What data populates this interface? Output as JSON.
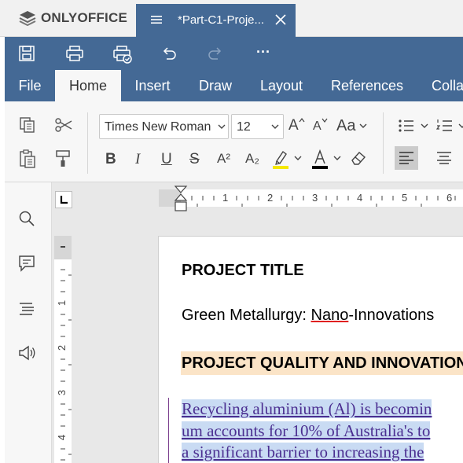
{
  "app": {
    "name": "ONLYOFFICE"
  },
  "document_tab": {
    "title": "*Part-C1-Proje..."
  },
  "quick_access": {
    "icons": [
      "save-icon",
      "print-icon",
      "quick-print-icon",
      "undo-icon",
      "redo-icon",
      "more-icon"
    ],
    "more_label": "···"
  },
  "ribbon_tabs": [
    "File",
    "Home",
    "Insert",
    "Draw",
    "Layout",
    "References",
    "Colla"
  ],
  "active_tab": "Home",
  "toolbar": {
    "font_name": "Times New Roman",
    "font_size": "12",
    "bold": "B",
    "italic": "I",
    "underline": "U",
    "strike": "S",
    "superscript": "A²",
    "subscript": "A₂",
    "highlight_color": "#f5e800",
    "font_color": "#000000",
    "grow_font": "A",
    "shrink_font": "A",
    "change_case": "Aa"
  },
  "left_panel": {
    "icons": [
      "search-icon",
      "comments-icon",
      "navigation-icon",
      "feedback-icon"
    ]
  },
  "rulers": {
    "horizontal_numbers": [
      "1",
      "2",
      "3",
      "4",
      "5",
      "6"
    ],
    "vertical_numbers": [
      "1",
      "2",
      "3",
      "4"
    ]
  },
  "document": {
    "heading1": "PROJECT TITLE",
    "line1_prefix": "Green Metallurgy: ",
    "line1_misspelled": "Nano",
    "line1_suffix": "-Innovations",
    "heading2": "PROJECT QUALITY AND INNOVATION",
    "paragraph_lines": [
      "Recycling aluminium (Al) is becomin",
      "um accounts for 10% of Australia's to",
      "a significant barrier to increasing the"
    ]
  },
  "colors": {
    "accent": "#446995",
    "tracked_change_text": "#4b2f91",
    "heading_highlight": "#fbe4c7",
    "selection": "#c9dbf3"
  }
}
